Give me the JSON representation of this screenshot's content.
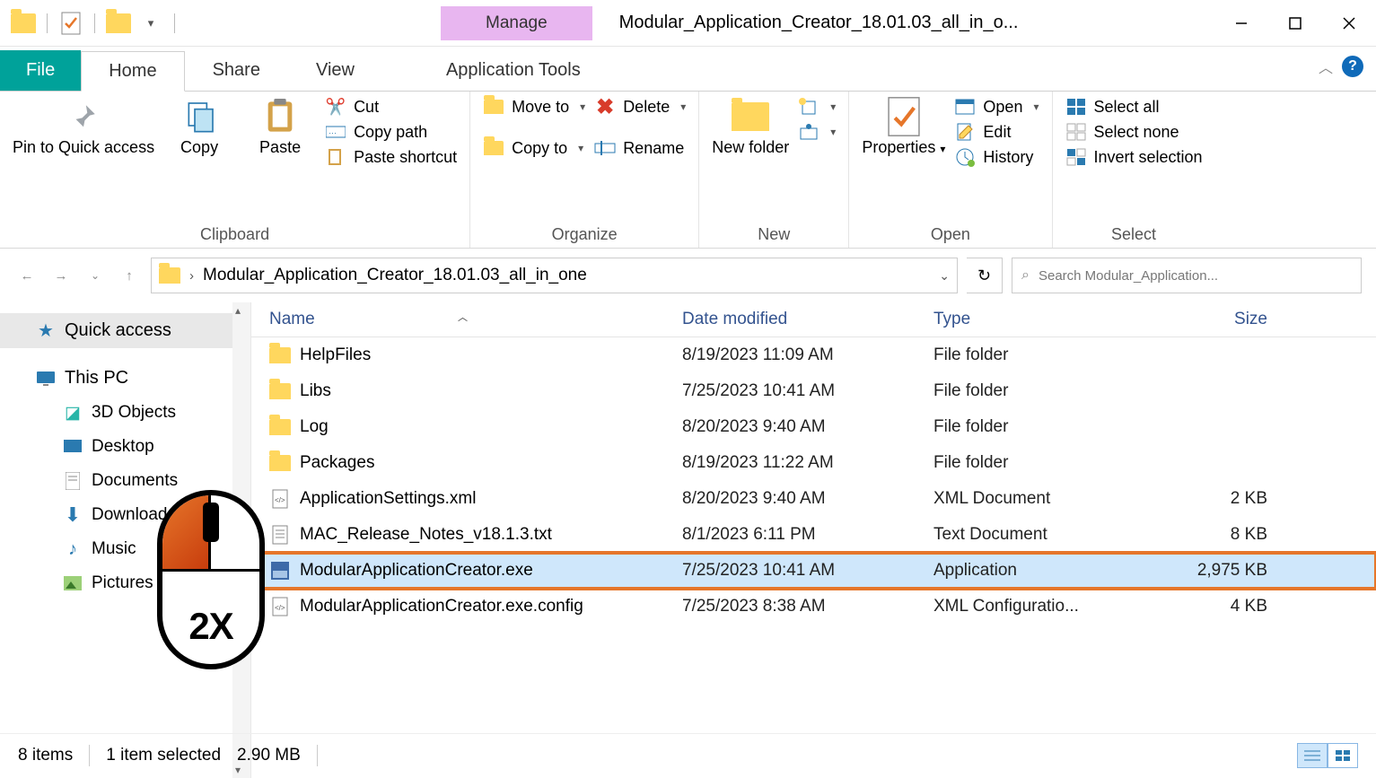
{
  "window": {
    "title": "Modular_Application_Creator_18.01.03_all_in_o...",
    "context_tab_group": "Manage",
    "context_tab": "Application Tools"
  },
  "tabs": {
    "file": "File",
    "home": "Home",
    "share": "Share",
    "view": "View"
  },
  "ribbon": {
    "clipboard": {
      "label": "Clipboard",
      "pin": "Pin to Quick access",
      "copy": "Copy",
      "paste": "Paste",
      "cut": "Cut",
      "copy_path": "Copy path",
      "paste_shortcut": "Paste shortcut"
    },
    "organize": {
      "label": "Organize",
      "move_to": "Move to",
      "copy_to": "Copy to",
      "delete": "Delete",
      "rename": "Rename"
    },
    "new": {
      "label": "New",
      "new_folder": "New folder"
    },
    "open": {
      "label": "Open",
      "properties": "Properties",
      "open": "Open",
      "edit": "Edit",
      "history": "History"
    },
    "select": {
      "label": "Select",
      "select_all": "Select all",
      "select_none": "Select none",
      "invert": "Invert selection"
    }
  },
  "nav": {
    "path": "Modular_Application_Creator_18.01.03_all_in_one",
    "search_placeholder": "Search Modular_Application..."
  },
  "sidebar": {
    "quick_access": "Quick access",
    "this_pc": "This PC",
    "items": [
      {
        "label": "3D Objects"
      },
      {
        "label": "Desktop"
      },
      {
        "label": "Documents"
      },
      {
        "label": "Downloads"
      },
      {
        "label": "Music"
      },
      {
        "label": "Pictures"
      }
    ]
  },
  "columns": {
    "name": "Name",
    "date": "Date modified",
    "type": "Type",
    "size": "Size"
  },
  "files": [
    {
      "icon": "folder",
      "name": "HelpFiles",
      "date": "8/19/2023 11:09 AM",
      "type": "File folder",
      "size": ""
    },
    {
      "icon": "folder",
      "name": "Libs",
      "date": "7/25/2023 10:41 AM",
      "type": "File folder",
      "size": ""
    },
    {
      "icon": "folder",
      "name": "Log",
      "date": "8/20/2023 9:40 AM",
      "type": "File folder",
      "size": ""
    },
    {
      "icon": "folder",
      "name": "Packages",
      "date": "8/19/2023 11:22 AM",
      "type": "File folder",
      "size": ""
    },
    {
      "icon": "xml",
      "name": "ApplicationSettings.xml",
      "date": "8/20/2023 9:40 AM",
      "type": "XML Document",
      "size": "2 KB"
    },
    {
      "icon": "txt",
      "name": "MAC_Release_Notes_v18.1.3.txt",
      "date": "8/1/2023 6:11 PM",
      "type": "Text Document",
      "size": "8 KB"
    },
    {
      "icon": "exe",
      "name": "ModularApplicationCreator.exe",
      "date": "7/25/2023 10:41 AM",
      "type": "Application",
      "size": "2,975 KB",
      "selected": true
    },
    {
      "icon": "cfg",
      "name": "ModularApplicationCreator.exe.config",
      "date": "7/25/2023 8:38 AM",
      "type": "XML Configuratio...",
      "size": "4 KB"
    }
  ],
  "status": {
    "count": "8 items",
    "selection": "1 item selected",
    "size": "2.90 MB"
  },
  "annotation": {
    "dblclick": "2X"
  }
}
